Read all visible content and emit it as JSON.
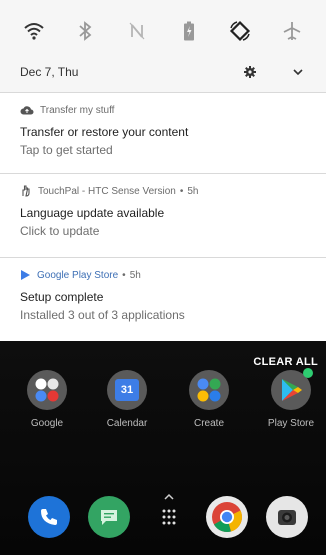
{
  "quick_settings": {
    "tiles": [
      "wifi",
      "bluetooth",
      "nfc",
      "battery-saver",
      "auto-rotate",
      "airplane-mode"
    ]
  },
  "header": {
    "date": "Dec 7, Thu"
  },
  "notifications": [
    {
      "app": "Transfer my stuff",
      "time": "",
      "title": "Transfer or restore your content",
      "text": "Tap to get started"
    },
    {
      "app": "TouchPal - HTC Sense Version",
      "time": "5h",
      "title": "Language update available",
      "text": "Click to update"
    },
    {
      "app": "Google Play Store",
      "time": "5h",
      "title": "Setup complete",
      "text": "Installed 3 out of 3 applications"
    }
  ],
  "clear_all_label": "CLEAR ALL",
  "home_apps": [
    {
      "label": "Google"
    },
    {
      "label": "Calendar",
      "badge": "31"
    },
    {
      "label": "Create"
    },
    {
      "label": "Play Store"
    }
  ],
  "dock": [
    "phone",
    "messages",
    "app-drawer",
    "chrome",
    "camera"
  ]
}
